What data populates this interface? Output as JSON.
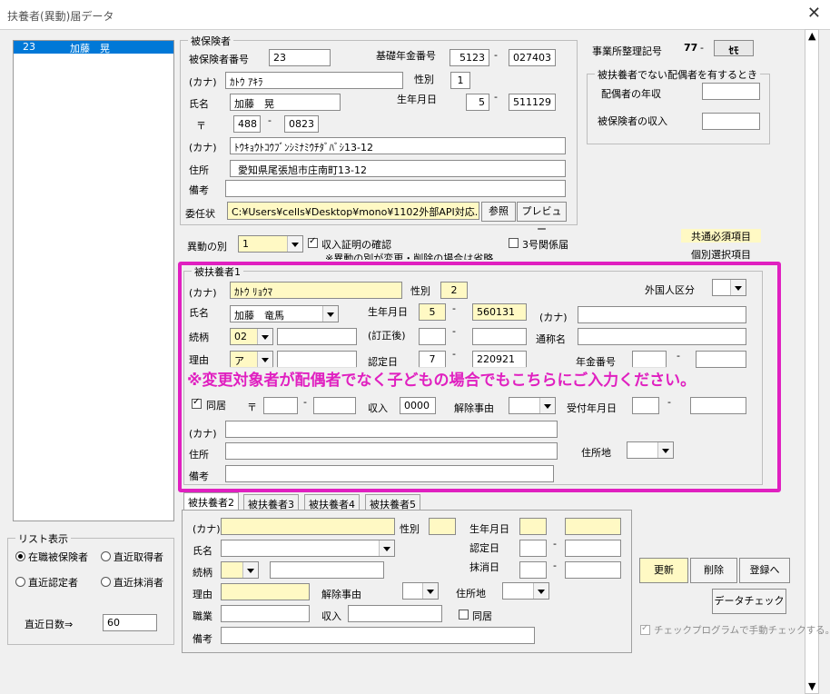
{
  "window": {
    "title": "扶養者(異動)届データ",
    "close_glyph": "✕"
  },
  "list": {
    "items": [
      {
        "no": "23",
        "name": "加藤　晃"
      }
    ]
  },
  "list_display": {
    "label": "リスト表示",
    "options": [
      "在職被保険者",
      "直近取得者",
      "直近認定者",
      "直近抹消者"
    ],
    "recent_days_label": "直近日数⇒",
    "recent_days": "60"
  },
  "insured": {
    "group_label": "被保険者",
    "number_label": "被保険者番号",
    "number": "23",
    "pension_label": "基礎年金番号",
    "pension1": "5123",
    "pension2": "027403",
    "kana_label": "(カナ)",
    "kana": "ｶﾄｳ ｱｷﾗ",
    "sex_label": "性別",
    "sex": "1",
    "name_label": "氏名",
    "name": "加藤　晃",
    "birth_label": "生年月日",
    "birth1": "5",
    "birth2": "511129",
    "zip_label": "〒",
    "zip1": "488",
    "zip2": "0823",
    "addr_kana_label": "(カナ)",
    "addr_kana": "ﾄｳｷｮｳﾄｺｳﾌﾞﾝｼﾐﾅﾐｳﾁﾀﾞﾊﾞｼ13-12",
    "addr_label": "住所",
    "addr": "愛知県尾張旭市庄南町13-12",
    "remark_label": "備考",
    "remark": "",
    "proxy_label": "委任状",
    "proxy_path": "C:¥Users¥cells¥Desktop¥mono¥1102外部API対応.pd",
    "browse_label": "参照",
    "preview_label": "プレビュー"
  },
  "office": {
    "label": "事業所整理記号",
    "code1": "77",
    "code2": "ｾﾓ"
  },
  "spouse_group": {
    "label": "被扶養者でない配偶者を有するとき",
    "annual_label": "配偶者の年収",
    "insured_income_label": "被保険者の収入"
  },
  "legend": {
    "common": "共通必須項目",
    "individual": "個別選択項目"
  },
  "change": {
    "type_label": "異動の別",
    "type": "1",
    "income_cert_label": "収入証明の確認",
    "note": "※異動の別が変更・削除の場合は省略",
    "form3_label": "3号関係届"
  },
  "dep1": {
    "group_label": "被扶養者1",
    "kana_label": "(カナ)",
    "kana": "ｶﾄｳ ﾘｮｳﾏ",
    "sex_label": "性別",
    "sex": "2",
    "foreign_label": "外国人区分",
    "name_label": "氏名",
    "name": "加藤　竜馬",
    "birth_label": "生年月日",
    "birth1": "5",
    "birth2": "560131",
    "kana2_label": "(カナ)",
    "relation_label": "続柄",
    "relation": "02",
    "corrected_label": "(訂正後)",
    "alias_label": "通称名",
    "reason_label": "理由",
    "reason": "ア",
    "cert_label": "認定日",
    "cert1": "7",
    "cert2": "220921",
    "pension_label": "年金番号",
    "livewith_label": "同居",
    "zip_label": "〒",
    "income_label": "収入",
    "income": "0000",
    "cancel_label": "解除事由",
    "received_label": "受付年月日",
    "addr_kana_label": "(カナ)",
    "addr_label": "住所",
    "addr_place_label": "住所地",
    "remark_label": "備考",
    "annotation": "※変更対象者が配偶者でなく子どもの場合でもこちらにご入力ください。"
  },
  "tabs": [
    "被扶養者2",
    "被扶養者3",
    "被扶養者4",
    "被扶養者5"
  ],
  "dep2": {
    "kana_label": "(カナ)",
    "sex_label": "性別",
    "birth_label": "生年月日",
    "name_label": "氏名",
    "cert_label": "認定日",
    "relation_label": "続柄",
    "erase_label": "抹消日",
    "reason_label": "理由",
    "cancel_label": "解除事由",
    "addr_place_label": "住所地",
    "job_label": "職業",
    "income_label": "収入",
    "livewith_label": "同居",
    "remark_label": "備考"
  },
  "actions": {
    "update": "更新",
    "delete": "削除",
    "register": "登録へ",
    "datacheck": "データチェック",
    "manual_check": "チェックプログラムで手動チェックする。"
  },
  "colors": {
    "highlight": "#e020c0",
    "field_yellow": "#fff9c4",
    "list_select": "#0078d7"
  }
}
